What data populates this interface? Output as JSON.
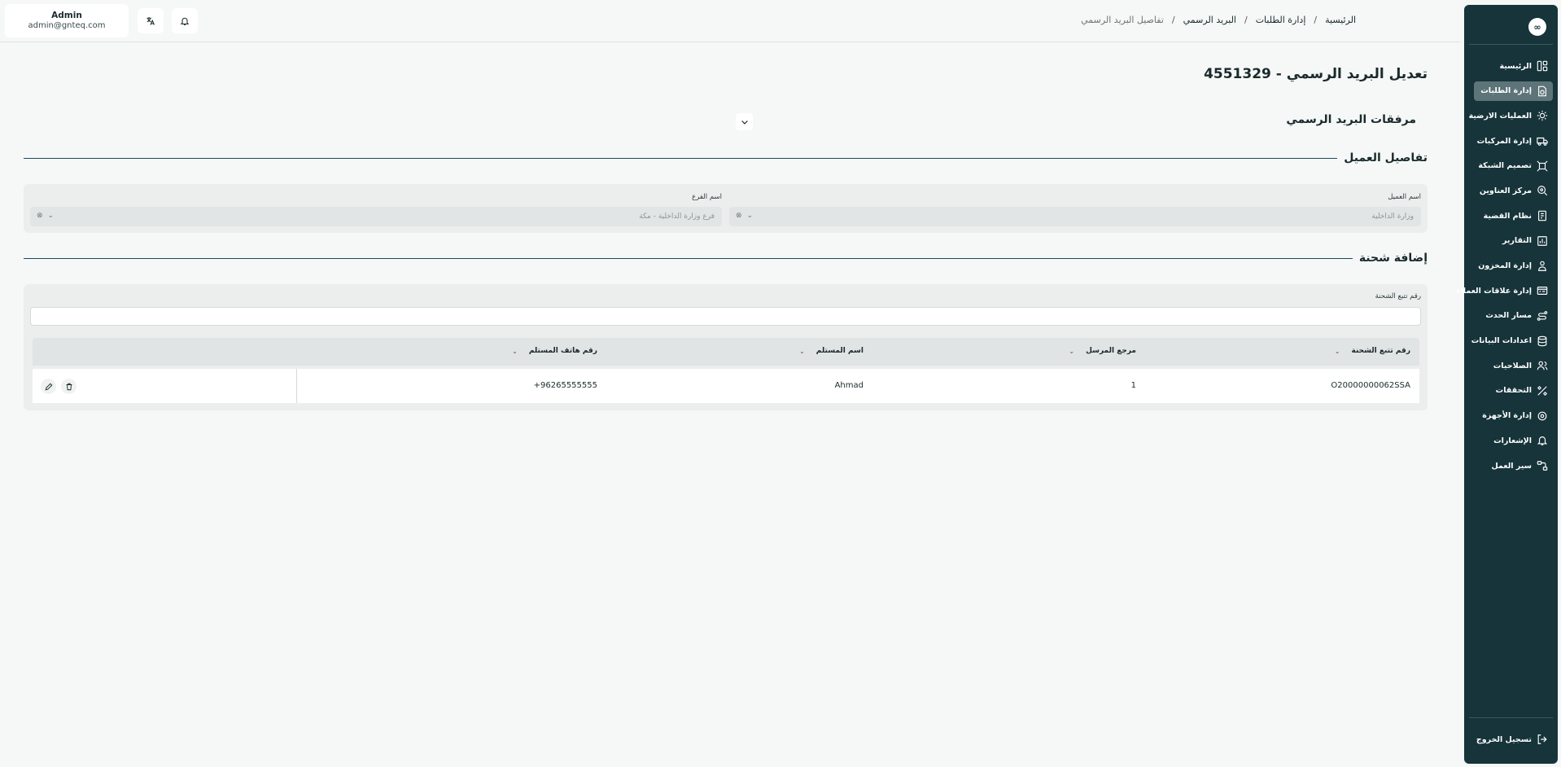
{
  "topbar": {
    "user_name": "Admin",
    "user_email": "admin@gnteq.com",
    "translate_icon": "translate-icon",
    "bell_icon": "bell-icon"
  },
  "breadcrumb": {
    "home": "الرئيسية",
    "requests": "إدارة الطلبات",
    "mail": "البريد الرسمي",
    "current": "تفاصيل البريد الرسمي",
    "separator": "/"
  },
  "sidebar": {
    "logo": "∞",
    "items": [
      {
        "label": "الرئيسية",
        "icon": "dashboard-icon"
      },
      {
        "label": "إدارة الطلبات",
        "icon": "requests-icon"
      },
      {
        "label": "العمليات الارضية",
        "icon": "ground-ops-icon"
      },
      {
        "label": "إدارة المركبات",
        "icon": "truck-icon"
      },
      {
        "label": "تصميم الشبكة",
        "icon": "network-icon"
      },
      {
        "label": "مركز العناوين",
        "icon": "address-icon"
      },
      {
        "label": "نظام القضية",
        "icon": "case-icon"
      },
      {
        "label": "التقارير",
        "icon": "reports-icon"
      },
      {
        "label": "إدارة المخزون",
        "icon": "inventory-icon"
      },
      {
        "label": "إدارة علاقات العملاء",
        "icon": "crm-icon"
      },
      {
        "label": "مسار الحدث",
        "icon": "route-icon"
      },
      {
        "label": "اعدادات البيانات",
        "icon": "database-icon"
      },
      {
        "label": "الصلاحيات",
        "icon": "users-icon"
      },
      {
        "label": "التحققات",
        "icon": "tools-icon"
      },
      {
        "label": "إدارة الأجهزة",
        "icon": "device-icon"
      },
      {
        "label": "الإشعارات",
        "icon": "bell-icon"
      },
      {
        "label": "سير العمل",
        "icon": "workflow-icon"
      }
    ],
    "active_index": 1,
    "logout": "تسجيل الخروج"
  },
  "page": {
    "title": "تعديل البريد الرسمي - 4551329",
    "attachments_title": "مرفقات البريد الرسمي"
  },
  "client_details": {
    "section_title": "تفاصيل العميل",
    "client_name_label": "اسم العميل",
    "client_name_value": "وزارة الداخلية",
    "branch_label": "اسم الفرع",
    "branch_value": "فرع وزارة الداخلية - مكة"
  },
  "shipment": {
    "section_title": "إضافة شحنة",
    "tracking_label": "رقم تتبع الشحنة",
    "tracking_value": "",
    "columns": {
      "tracking": "رقم تتبع الشحنة",
      "sender_ref": "مرجع المرسل",
      "receiver_name": "اسم المستلم",
      "receiver_phone": "رقم هاتف المستلم"
    },
    "rows": [
      {
        "tracking": "O20000000062SSA",
        "sender_ref": "1",
        "receiver_name": "Ahmad",
        "receiver_phone": "+96265555555"
      }
    ]
  },
  "colors": {
    "sidebar_bg": "#16343a",
    "active_item": "#5d7479",
    "accent_line": "#1d4a5a"
  }
}
